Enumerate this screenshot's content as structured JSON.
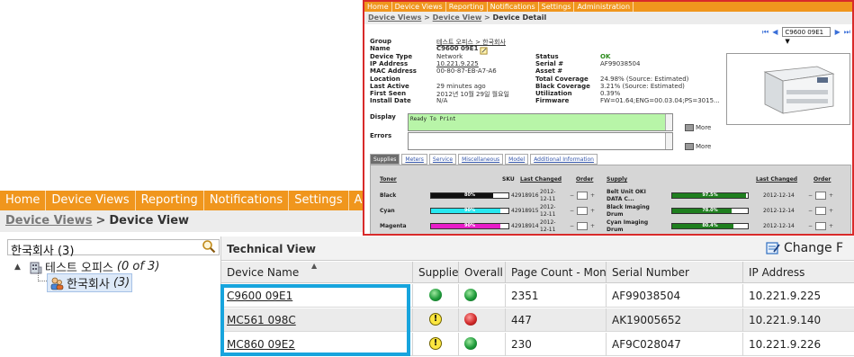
{
  "main": {
    "nav": [
      "Home",
      "Device Views",
      "Reporting",
      "Notifications",
      "Settings",
      "Adm"
    ],
    "breadcrumb": {
      "link": "Device Views",
      "separator": ">",
      "current": "Device View"
    },
    "tree": {
      "search_value": "한국회사 (3)",
      "root": {
        "label": "테스트 오피스",
        "count": "(0 of 3)",
        "toggle": "▲"
      },
      "child": {
        "label": "한국회사",
        "count": "(3)"
      }
    },
    "technical_view": {
      "title": "Technical View",
      "change_label": "Change F",
      "columns": [
        "Device Name",
        "Supplies",
        "Overall S",
        "Page Count - Month",
        "Serial Number",
        "IP Address"
      ],
      "rows": [
        {
          "device": "C9600 09E1",
          "supplies": "green",
          "overall": "green",
          "pages": "2351",
          "serial": "AF99038504",
          "ip": "10.221.9.225"
        },
        {
          "device": "MC561 098C",
          "supplies": "warning",
          "overall": "red",
          "pages": "447",
          "serial": "AK19005652",
          "ip": "10.221.9.140"
        },
        {
          "device": "MC860 09E2",
          "supplies": "warning",
          "overall": "green",
          "pages": "230",
          "serial": "AF9C028047",
          "ip": "10.221.9.226"
        }
      ]
    }
  },
  "popup": {
    "nav": [
      "Home",
      "Device Views",
      "Reporting",
      "Notifications",
      "Settings",
      "Administration"
    ],
    "breadcrumb": {
      "link1": "Device Views",
      "link2": "Device View",
      "current": "Device Detail"
    },
    "pager": {
      "selected": "C9600 09E1",
      "dropdown_arrow": "▼"
    },
    "detail_left": [
      {
        "label": "Group",
        "value": "테스트 오피스 > 한국회사",
        "link": true
      },
      {
        "label": "Name",
        "value": "C9600 09E1",
        "bold": true
      },
      {
        "label": "Device Type",
        "value": "Network"
      },
      {
        "label": "IP Address",
        "value": "10.221.9.225",
        "link": true
      },
      {
        "label": "MAC Address",
        "value": "00-80-87-EB-A7-A6"
      },
      {
        "label": "Location",
        "value": ""
      },
      {
        "label": "Last Active",
        "value": "29 minutes ago"
      },
      {
        "label": "First Seen",
        "value": "2012년 10월 29일 월요일"
      },
      {
        "label": "Install Date",
        "value": "N/A"
      }
    ],
    "detail_right": [
      {
        "label": "Status",
        "value": "OK",
        "ok": true
      },
      {
        "label": "Serial #",
        "value": "AF99038504"
      },
      {
        "label": "Asset #",
        "value": ""
      },
      {
        "label": "Total Coverage",
        "value": "24.98% (Source: Estimated)"
      },
      {
        "label": "Black Coverage",
        "value": "3.21% (Source: Estimated)"
      },
      {
        "label": "Utilization",
        "value": "0.39%"
      },
      {
        "label": "Firmware",
        "value": "FW=01.64;ENG=00.03.04;PS=3015..."
      }
    ],
    "display_label": "Display",
    "display_text": "Ready To Print",
    "errors_label": "Errors",
    "more_label": "More",
    "tabs": [
      "Supplies",
      "Meters",
      "Service",
      "Miscellaneous",
      "Model",
      "Additional Information"
    ],
    "supplies": {
      "headers": {
        "toner": "Toner",
        "sku": "SKU",
        "last_changed": "Last Changed",
        "order": "Order",
        "supply": "Supply"
      },
      "toner_rows": [
        {
          "name": "Black",
          "level": 0.8,
          "pct": "80%",
          "color": "#111111",
          "sku": "42918916",
          "changed1": "2012-",
          "changed2": "12-11"
        },
        {
          "name": "Cyan",
          "level": 0.9,
          "pct": "90%",
          "color": "#27e8f0",
          "sku": "42918915",
          "changed1": "2012-",
          "changed2": "12-11"
        },
        {
          "name": "Magenta",
          "level": 0.9,
          "pct": "90%",
          "color": "#e81cc8",
          "sku": "42918914",
          "changed1": "2012-",
          "changed2": "12-11"
        }
      ],
      "supply_rows": [
        {
          "name1": "Belt Unit OKI",
          "name2": "DATA C...",
          "level": 0.975,
          "pct": "97.5%",
          "changed": "2012-12-14"
        },
        {
          "name1": "Black Imaging",
          "name2": "Drum",
          "level": 0.78,
          "pct": "78.0%",
          "changed": "2012-12-14"
        },
        {
          "name1": "Cyan Imaging",
          "name2": "Drum",
          "level": 0.804,
          "pct": "80.4%",
          "changed": "2012-12-14"
        }
      ],
      "supply_color": "#1f7f1f",
      "minus": "−",
      "plus": "+"
    }
  }
}
